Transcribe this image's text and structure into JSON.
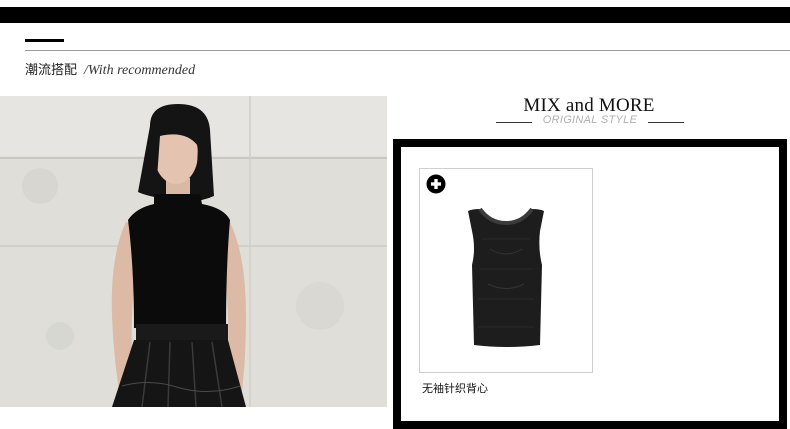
{
  "section": {
    "title_cn": "潮流搭配",
    "title_en": "/With recommended"
  },
  "mix": {
    "title": "MIX and MORE",
    "subtitle": "ORIGINAL STYLE"
  },
  "product": {
    "name": "无袖针织背心",
    "icon": "plus-circle-icon"
  },
  "photo": {
    "subject": "model-photo",
    "colors": {
      "background": "#dcdbd6",
      "garment": "#0b0b0b"
    }
  },
  "colors": {
    "accent": "#000000",
    "subtitle": "#b0b0b0",
    "rule": "#9a9a9a"
  }
}
